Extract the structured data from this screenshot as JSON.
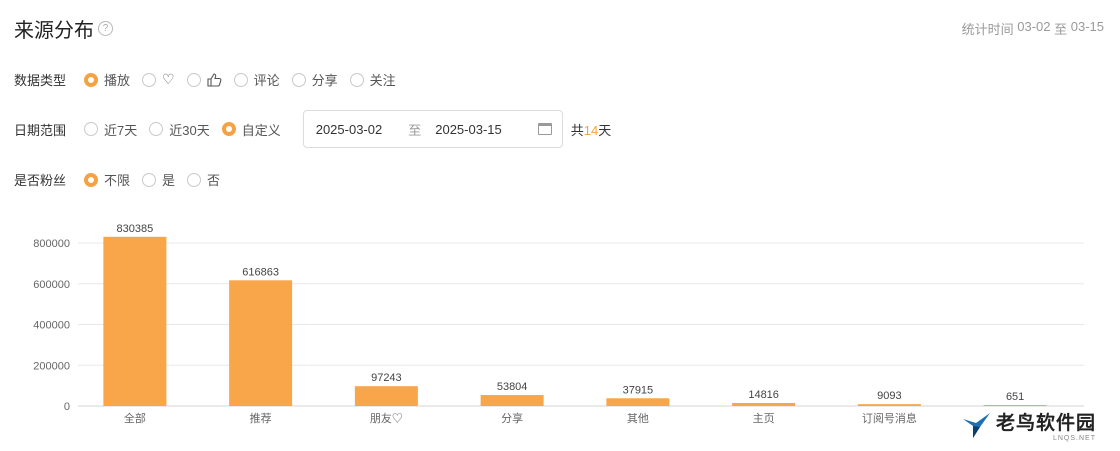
{
  "header": {
    "title": "来源分布",
    "help_glyph": "?"
  },
  "stat_time": {
    "label": "统计时间",
    "start": "03-02",
    "to": "至",
    "end": "03-15"
  },
  "data_type": {
    "label": "数据类型",
    "options": [
      {
        "label": "播放",
        "checked": true,
        "icon": ""
      },
      {
        "label": "",
        "checked": false,
        "icon": "heart-icon",
        "glyph": "♡"
      },
      {
        "label": "",
        "checked": false,
        "icon": "thumbs-up-icon",
        "glyph": "👍"
      },
      {
        "label": "评论",
        "checked": false,
        "icon": ""
      },
      {
        "label": "分享",
        "checked": false,
        "icon": ""
      },
      {
        "label": "关注",
        "checked": false,
        "icon": ""
      }
    ]
  },
  "date_range": {
    "label": "日期范围",
    "options": [
      {
        "label": "近7天",
        "checked": false
      },
      {
        "label": "近30天",
        "checked": false
      },
      {
        "label": "自定义",
        "checked": true
      }
    ],
    "start": "2025-03-02",
    "to": "至",
    "end": "2025-03-15",
    "total_prefix": "共",
    "total_days": "14",
    "total_suffix": "天"
  },
  "is_fan": {
    "label": "是否粉丝",
    "options": [
      {
        "label": "不限",
        "checked": true
      },
      {
        "label": "是",
        "checked": false
      },
      {
        "label": "否",
        "checked": false
      }
    ]
  },
  "chart_data": {
    "type": "bar",
    "categories": [
      "全部",
      "推荐",
      "朋友♡",
      "分享",
      "其他",
      "主页",
      "订阅号消息",
      ""
    ],
    "values": [
      830385,
      616863,
      97243,
      53804,
      37915,
      14816,
      9093,
      651
    ],
    "yticks": [
      0,
      200000,
      400000,
      600000,
      800000
    ],
    "ylim": [
      0,
      800000
    ],
    "bar_color": "#f9a54a",
    "grid": true
  },
  "watermark": {
    "main": "老鸟软件园",
    "sub": "LNQS.NET"
  }
}
